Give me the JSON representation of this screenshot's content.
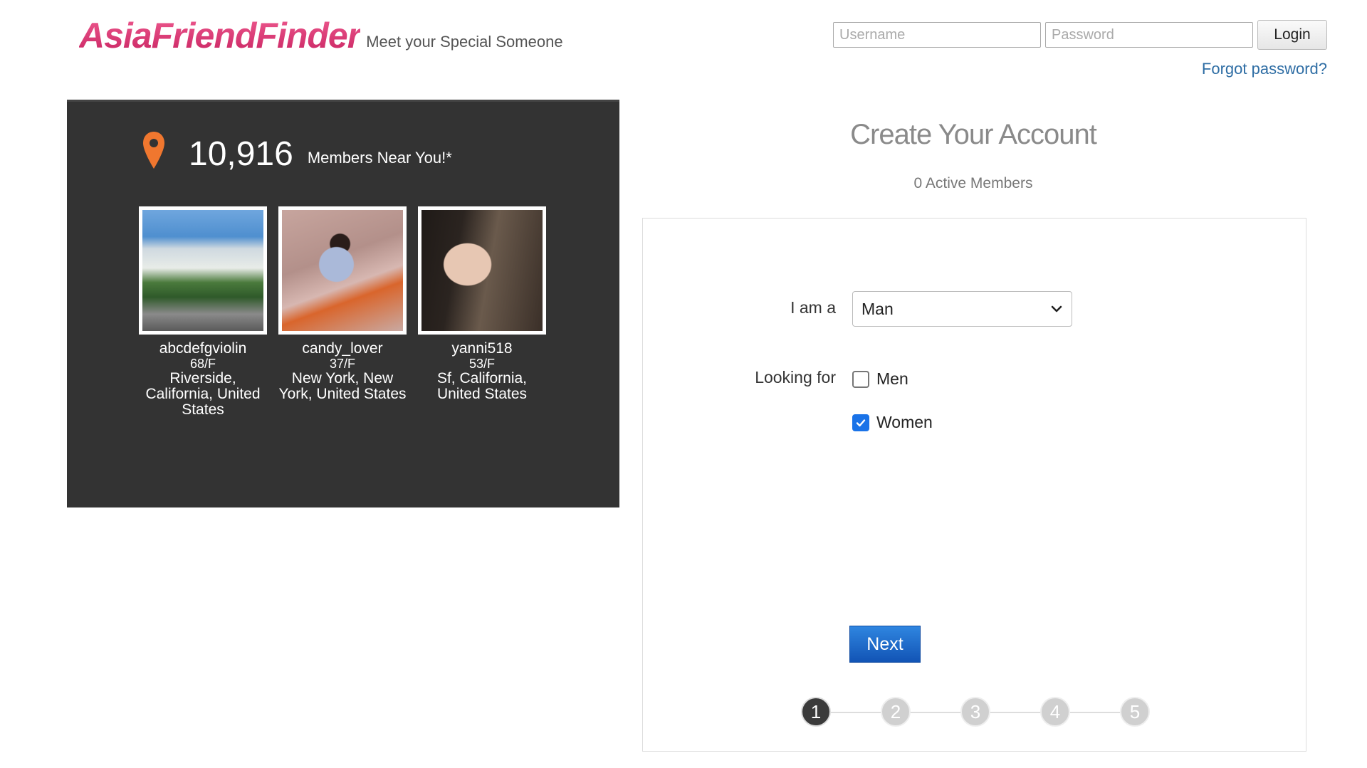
{
  "header": {
    "logo_text": "AsiaFriendFinder",
    "tagline": "Meet your Special Someone",
    "username_placeholder": "Username",
    "password_placeholder": "Password",
    "login_label": "Login",
    "forgot_label": "Forgot password?"
  },
  "members_panel": {
    "count": "10,916",
    "near_text": "Members Near You!*",
    "profiles": [
      {
        "name": "abcdefgviolin",
        "meta": "68/F",
        "location": "Riverside, California, United States"
      },
      {
        "name": "candy_lover",
        "meta": "37/F",
        "location": "New York, New York, United States"
      },
      {
        "name": "yanni518",
        "meta": "53/F",
        "location": "Sf, California, United States"
      }
    ]
  },
  "signup": {
    "title": "Create Your Account",
    "active_members": "0 Active Members",
    "i_am_label": "I am a",
    "i_am_value": "Man",
    "looking_for_label": "Looking for",
    "options": [
      {
        "label": "Men",
        "checked": false
      },
      {
        "label": "Women",
        "checked": true
      }
    ],
    "next_label": "Next",
    "steps": [
      "1",
      "2",
      "3",
      "4",
      "5"
    ],
    "active_step": 1
  },
  "colors": {
    "brand": "#d6336c",
    "panel_bg": "#333333",
    "link": "#2e6da4",
    "next_button": "#1a64c8",
    "pin": "#f0772f"
  }
}
